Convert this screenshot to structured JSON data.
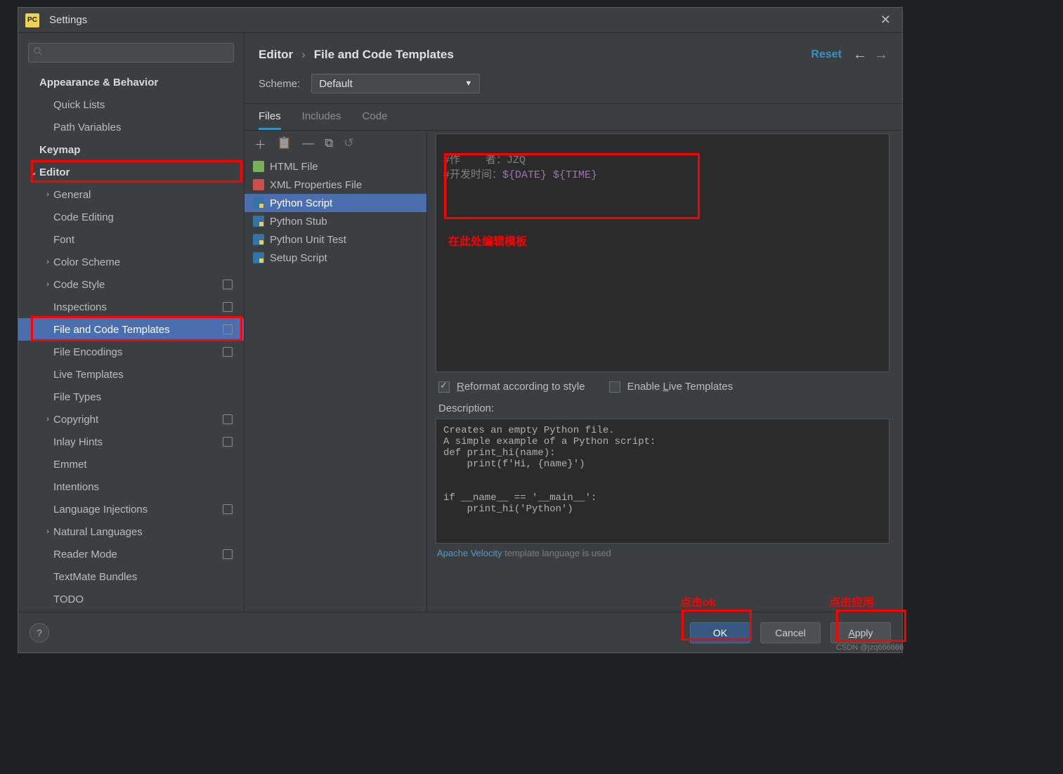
{
  "window": {
    "title": "Settings",
    "close_glyph": "✕"
  },
  "search": {
    "placeholder": ""
  },
  "sidebar": {
    "items": [
      {
        "label": "Appearance & Behavior",
        "level": 0,
        "cat": true,
        "arrow": "none"
      },
      {
        "label": "Quick Lists",
        "level": 1,
        "arrow": "none"
      },
      {
        "label": "Path Variables",
        "level": 1,
        "arrow": "none"
      },
      {
        "label": "Keymap",
        "level": 0,
        "cat": true,
        "arrow": "none"
      },
      {
        "label": "Editor",
        "level": 0,
        "cat": true,
        "arrow": "down",
        "highlight": true
      },
      {
        "label": "General",
        "level": 1,
        "arrow": "right"
      },
      {
        "label": "Code Editing",
        "level": 1,
        "arrow": "none"
      },
      {
        "label": "Font",
        "level": 1,
        "arrow": "none"
      },
      {
        "label": "Color Scheme",
        "level": 1,
        "arrow": "right"
      },
      {
        "label": "Code Style",
        "level": 1,
        "arrow": "right",
        "badge": true
      },
      {
        "label": "Inspections",
        "level": 1,
        "arrow": "none",
        "badge": true
      },
      {
        "label": "File and Code Templates",
        "level": 1,
        "arrow": "none",
        "badge": true,
        "selected": true,
        "highlight": true
      },
      {
        "label": "File Encodings",
        "level": 1,
        "arrow": "none",
        "badge": true
      },
      {
        "label": "Live Templates",
        "level": 1,
        "arrow": "none"
      },
      {
        "label": "File Types",
        "level": 1,
        "arrow": "none"
      },
      {
        "label": "Copyright",
        "level": 1,
        "arrow": "right",
        "badge": true
      },
      {
        "label": "Inlay Hints",
        "level": 1,
        "arrow": "none",
        "badge": true
      },
      {
        "label": "Emmet",
        "level": 1,
        "arrow": "none"
      },
      {
        "label": "Intentions",
        "level": 1,
        "arrow": "none"
      },
      {
        "label": "Language Injections",
        "level": 1,
        "arrow": "none",
        "badge": true
      },
      {
        "label": "Natural Languages",
        "level": 1,
        "arrow": "right"
      },
      {
        "label": "Reader Mode",
        "level": 1,
        "arrow": "none",
        "badge": true
      },
      {
        "label": "TextMate Bundles",
        "level": 1,
        "arrow": "none"
      },
      {
        "label": "TODO",
        "level": 1,
        "arrow": "none"
      }
    ]
  },
  "breadcrumb": {
    "parts": [
      "Editor",
      "File and Code Templates"
    ],
    "sep": "›"
  },
  "reset_label": "Reset",
  "scheme": {
    "label": "Scheme:",
    "value": "Default"
  },
  "tabs": [
    "Files",
    "Includes",
    "Code"
  ],
  "active_tab": 0,
  "toolbar_glyphs": {
    "add": "＋",
    "add_group": "📋",
    "remove": "—",
    "copy": "⧉",
    "revert": "↺"
  },
  "templates": [
    {
      "name": "HTML File",
      "icon": "html"
    },
    {
      "name": "XML Properties File",
      "icon": "xml"
    },
    {
      "name": "Python Script",
      "icon": "py",
      "selected": true
    },
    {
      "name": "Python Stub",
      "icon": "py"
    },
    {
      "name": "Python Unit Test",
      "icon": "py"
    },
    {
      "name": "Setup Script",
      "icon": "py"
    }
  ],
  "code_comment1": "#作    者：JZQ",
  "code_comment2_a": "#开发时间：",
  "code_comment2_b": "${DATE} ${TIME}",
  "checks": {
    "reformat": "Reformat according to style",
    "enable_live": "Enable Live Templates"
  },
  "reformat_checked": true,
  "enable_live_checked": false,
  "description_label": "Description:",
  "description_text": "Creates an empty Python file.\nA simple example of a Python script:\ndef print_hi(name):\n    print(f'Hi, {name}')\n\n\nif __name__ == '__main__':\n    print_hi('Python')",
  "velocity_note_link": "Apache Velocity",
  "velocity_note_rest": " template language is used",
  "buttons": {
    "ok": "OK",
    "cancel": "Cancel",
    "apply": "Apply"
  },
  "annotations": {
    "edit_template": "在此处编辑模板",
    "click_ok": "点击ok",
    "click_apply": "点击应用"
  },
  "watermark": "CSDN @jzq666666"
}
